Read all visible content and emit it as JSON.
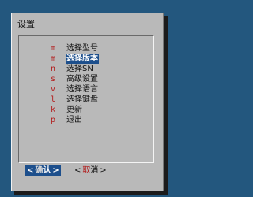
{
  "dialog": {
    "title": "设置",
    "menu": [
      {
        "tag": "m",
        "label": "选择型号",
        "selected": false
      },
      {
        "tag": "m",
        "label": "选择版本",
        "selected": true
      },
      {
        "tag": "n",
        "label": "选择SN",
        "selected": false
      },
      {
        "tag": "s",
        "label": "高级设置",
        "selected": false
      },
      {
        "tag": "v",
        "label": "选择语言",
        "selected": false
      },
      {
        "tag": "l",
        "label": "选择键盘",
        "selected": false
      },
      {
        "tag": "k",
        "label": "更新",
        "selected": false
      },
      {
        "tag": "p",
        "label": "退出",
        "selected": false
      }
    ],
    "ok_button": {
      "open": "<",
      "hot": "确",
      "rest": "认",
      "close": ">"
    },
    "cancel_button": {
      "open": "<",
      "hot": "取",
      "rest": "消",
      "close": ">"
    }
  },
  "colors": {
    "desktop": "#23577e",
    "dialog": "#b9b9b9",
    "highlight": "#1d4f8c",
    "tag": "#b21b1b"
  }
}
